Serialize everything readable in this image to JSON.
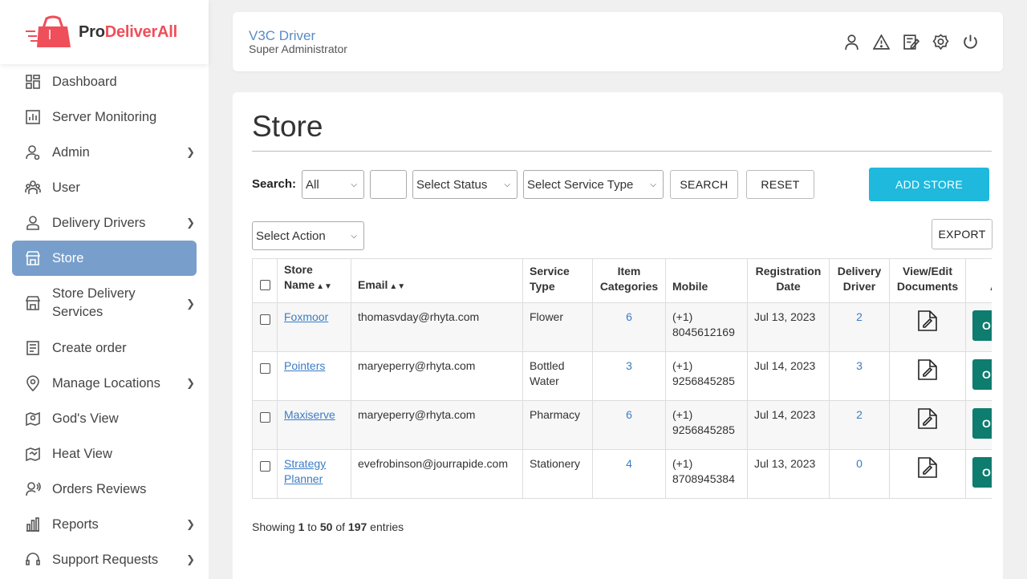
{
  "brand": {
    "name_part1": "Pro",
    "name_part2": "DeliverAll"
  },
  "sidebar": {
    "items": [
      {
        "label": "Dashboard",
        "has_children": false
      },
      {
        "label": "Server Monitoring",
        "has_children": false
      },
      {
        "label": "Admin",
        "has_children": true
      },
      {
        "label": "User",
        "has_children": false
      },
      {
        "label": "Delivery Drivers",
        "has_children": true
      },
      {
        "label": "Store",
        "has_children": false,
        "active": true
      },
      {
        "label": "Store Delivery Services",
        "has_children": true
      },
      {
        "label": "Create order",
        "has_children": false
      },
      {
        "label": "Manage Locations",
        "has_children": true
      },
      {
        "label": "God's View",
        "has_children": false
      },
      {
        "label": "Heat View",
        "has_children": false
      },
      {
        "label": "Orders Reviews",
        "has_children": false
      },
      {
        "label": "Reports",
        "has_children": true
      },
      {
        "label": "Support Requests",
        "has_children": true
      }
    ]
  },
  "header": {
    "user_name": "V3C Driver",
    "user_role": "Super Administrator",
    "icons": [
      "user-icon",
      "alert-icon",
      "edit-note-icon",
      "settings-icon",
      "power-icon"
    ]
  },
  "page": {
    "title": "Store",
    "search_label": "Search:",
    "search_field_value": "All",
    "search_text_value": "",
    "status_placeholder": "Select Status",
    "service_type_placeholder": "Select Service Type",
    "search_button": "SEARCH",
    "reset_button": "RESET",
    "add_button": "ADD STORE",
    "action_placeholder": "Select Action",
    "export_button": "EXPORT"
  },
  "table": {
    "headers": {
      "store_name": "Store Name",
      "email": "Email",
      "service_type": "Service Type",
      "item_categories": "Item Categories",
      "mobile": "Mobile",
      "registration_date": "Registration Date",
      "delivery_driver": "Delivery Driver",
      "documents": "View/Edit Documents",
      "action": "A"
    },
    "rows": [
      {
        "store": "Foxmoor",
        "email": "thomasvday@rhyta.com",
        "service": "Flower",
        "categories": "6",
        "code": "(+1)",
        "phone": "8045612169",
        "date": "Jul 13, 2023",
        "drivers": "2",
        "action": "O"
      },
      {
        "store": "Pointers",
        "email": "maryeperry@rhyta.com",
        "service": "Bottled Water",
        "categories": "3",
        "code": "(+1)",
        "phone": "9256845285",
        "date": "Jul 14, 2023",
        "drivers": "3",
        "action": "O"
      },
      {
        "store": "Maxiserve",
        "email": "maryeperry@rhyta.com",
        "service": "Pharmacy",
        "categories": "6",
        "code": "(+1)",
        "phone": "9256845285",
        "date": "Jul 14, 2023",
        "drivers": "2",
        "action": "O"
      },
      {
        "store": "Strategy Planner",
        "email": "evefrobinson@jourrapide.com",
        "service": "Stationery",
        "categories": "4",
        "code": "(+1)",
        "phone": "8708945384",
        "date": "Jul 13, 2023",
        "drivers": "0",
        "action": "O"
      }
    ]
  },
  "footer": {
    "prefix": "Showing",
    "from": "1",
    "to_word": "to",
    "to": "50",
    "of_word": "of",
    "total": "197",
    "suffix": "entries"
  },
  "colors": {
    "accent": "#789fcb",
    "primary_button": "#1eb9dd",
    "action_button": "#0e7c6e",
    "link": "#3b7cc4",
    "brand_red": "#ef4f5a"
  }
}
